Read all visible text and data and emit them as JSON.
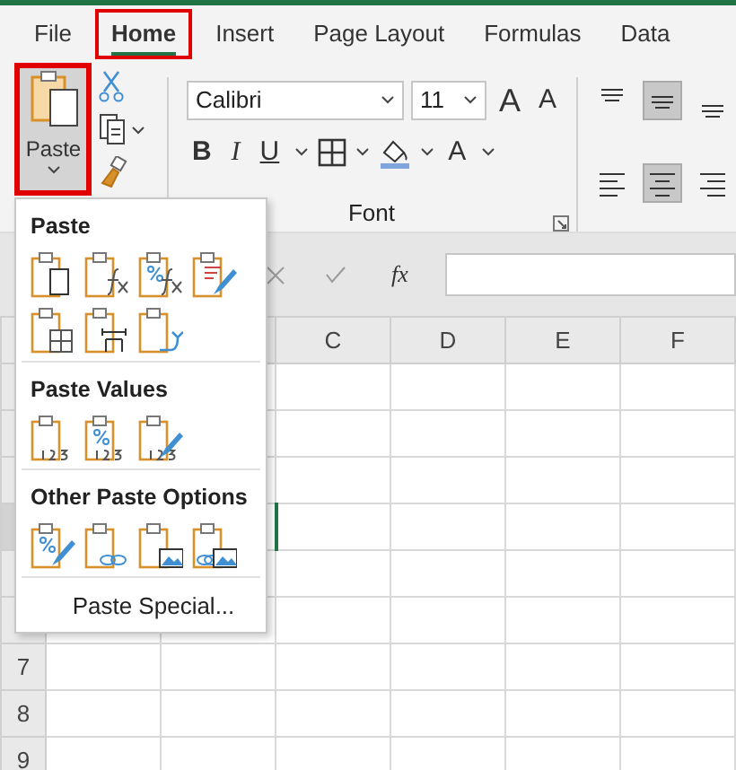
{
  "tabs": [
    {
      "label": "File",
      "selected": false,
      "highlighted": false
    },
    {
      "label": "Home",
      "selected": true,
      "highlighted": true
    },
    {
      "label": "Insert",
      "selected": false,
      "highlighted": false
    },
    {
      "label": "Page Layout",
      "selected": false,
      "highlighted": false
    },
    {
      "label": "Formulas",
      "selected": false,
      "highlighted": false
    },
    {
      "label": "Data",
      "selected": false,
      "highlighted": false
    }
  ],
  "clipboard": {
    "paste_label": "Paste",
    "highlighted": true,
    "expanded": true
  },
  "font_group": {
    "font_name": "Calibri",
    "font_size": "11",
    "grow_label": "A",
    "shrink_label": "A",
    "bold_label": "B",
    "italic_label": "I",
    "underline_label": "U",
    "font_color_label": "A",
    "group_label": "Font"
  },
  "alignment": [
    {
      "kind": "top",
      "selected": false
    },
    {
      "kind": "middle",
      "selected": true
    },
    {
      "kind": "bottom",
      "selected": false
    },
    {
      "kind": "left",
      "selected": false
    },
    {
      "kind": "center",
      "selected": true
    },
    {
      "kind": "right",
      "selected": false
    }
  ],
  "formula_bar": {
    "function_label": "fx"
  },
  "paste_menu": {
    "sections": [
      {
        "title": "Paste",
        "options": [
          {
            "kind": "paste"
          },
          {
            "kind": "formulas"
          },
          {
            "kind": "formulas_number"
          },
          {
            "kind": "keep_source"
          },
          {
            "kind": "no_borders"
          },
          {
            "kind": "column_widths"
          },
          {
            "kind": "transpose"
          }
        ]
      },
      {
        "title": "Paste Values",
        "options": [
          {
            "kind": "values"
          },
          {
            "kind": "values_number"
          },
          {
            "kind": "values_source"
          }
        ]
      },
      {
        "title": "Other Paste Options",
        "options": [
          {
            "kind": "formatting"
          },
          {
            "kind": "link"
          },
          {
            "kind": "picture"
          },
          {
            "kind": "linked_picture"
          }
        ]
      }
    ],
    "footer": "Paste Special..."
  },
  "grid": {
    "columns": [
      "C",
      "D",
      "E",
      "F"
    ],
    "rows": [
      "7",
      "8",
      "9"
    ]
  }
}
